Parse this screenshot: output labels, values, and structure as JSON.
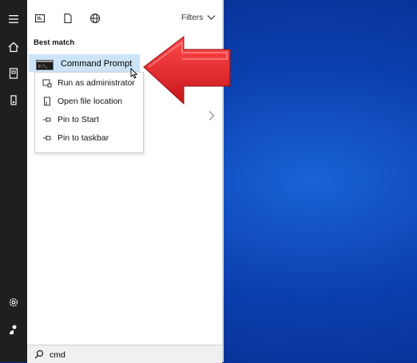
{
  "leftbar": {
    "icons": [
      "hamburger-icon",
      "home-icon",
      "documents-icon",
      "device-icon",
      "settings-icon",
      "user-icon"
    ]
  },
  "top_tabs": {
    "icons": [
      "apps-icon",
      "document-icon",
      "web-icon"
    ],
    "filters_label": "Filters"
  },
  "best_match": {
    "heading": "Best match",
    "result_label": "Command Prompt"
  },
  "context_menu": {
    "items": [
      {
        "label": "Run as administrator",
        "icon": "run-as-admin-icon"
      },
      {
        "label": "Open file location",
        "icon": "file-location-icon"
      },
      {
        "label": "Pin to Start",
        "icon": "pin-icon"
      },
      {
        "label": "Pin to taskbar",
        "icon": "pin-icon"
      }
    ]
  },
  "search": {
    "query": "cmd",
    "icon": "search-icon"
  },
  "colors": {
    "accent_arrow": "#e0262b",
    "highlight": "#cce4f7",
    "desktop_blue": "#0b3fae",
    "sidebar": "#1f1f1f"
  }
}
